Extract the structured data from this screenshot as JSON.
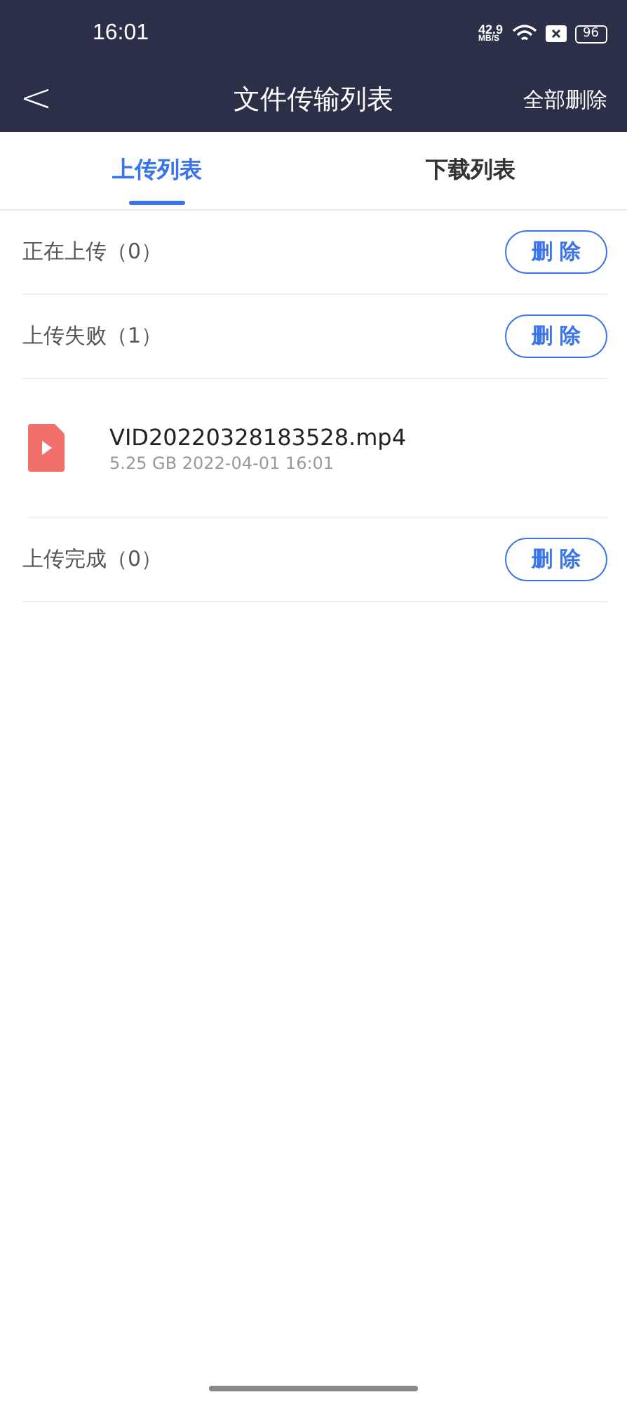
{
  "status_bar": {
    "time": "16:01",
    "speed": "42.9",
    "speed_unit": "MB/S",
    "battery": "96"
  },
  "header": {
    "back": "<",
    "title": "文件传输列表",
    "action": "全部删除"
  },
  "tabs": [
    {
      "label": "上传列表",
      "selected": true
    },
    {
      "label": "下载列表",
      "selected": false
    }
  ],
  "sections": [
    {
      "title": "正在上传（0）",
      "button": "删 除"
    },
    {
      "title": "上传失败（1）",
      "button": "删 除",
      "files": [
        {
          "name": "VID20220328183528.mp4",
          "meta": "5.25 GB 2022-04-01 16:01"
        }
      ]
    },
    {
      "title": "上传完成（0）",
      "button": "删 除"
    }
  ]
}
